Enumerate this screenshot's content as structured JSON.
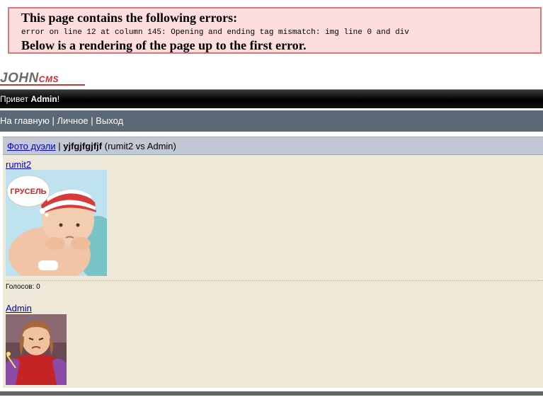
{
  "error": {
    "title": "This page contains the following errors:",
    "message": "error on line 12 at column 145: Opening and ending tag mismatch: img line 0 and div",
    "below": "Below is a rendering of the page up to the first error."
  },
  "logo": {
    "main": "JOHN",
    "sub": "CMS"
  },
  "greeting": {
    "prefix": "Привет ",
    "user": "Admin",
    "suffix": "!"
  },
  "nav": {
    "home": "На главную",
    "personal": "Личное",
    "exit": "Выход",
    "separator": " | "
  },
  "page_header": {
    "section_link": "Фото дуэли",
    "separator": " | ",
    "duel_name": "yjfgjfgjfjf",
    "duel_info": " (rumit2 vs Admin)"
  },
  "entries": [
    {
      "user": "rumit2",
      "photo_caption": "ГРУСЕЛЬ"
    },
    {
      "user": "Admin"
    }
  ],
  "votes_label": "Голосов: 0",
  "colors": {
    "error_bg": "#fddddd",
    "error_border": "#d47a7a",
    "nav_bg": "#5b6875",
    "content_bg": "#ede8d7",
    "header_bg": "#c4c8d4",
    "logo_red": "#d12a2a"
  }
}
